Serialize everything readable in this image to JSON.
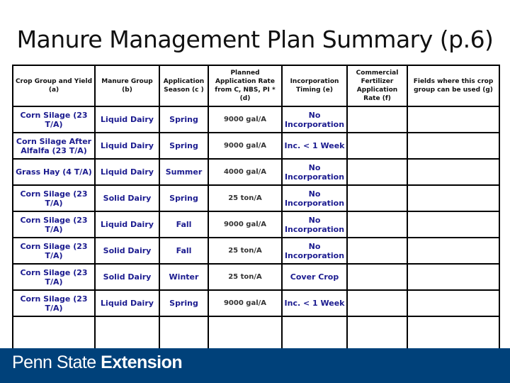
{
  "title": "Manure Management Plan Summary (p.6)",
  "table": {
    "headers": [
      "Crop Group and Yield (a)",
      "Manure Group (b)",
      "Application Season (c )",
      "Planned Application Rate from C, NBS, PI * (d)",
      "Incorporation Timing (e)",
      "Commercial Fertilizer Application Rate (f)",
      "Fields where this crop group can be used (g)"
    ],
    "rows": [
      [
        "Corn Silage (23 T/A)",
        "Liquid Dairy",
        "Spring",
        "9000 gal/A",
        "No Incorporation",
        "",
        ""
      ],
      [
        "Corn Silage After Alfalfa (23 T/A)",
        "Liquid Dairy",
        "Spring",
        "9000 gal/A",
        "Inc. < 1 Week",
        "",
        ""
      ],
      [
        "Grass Hay (4 T/A)",
        "Liquid Dairy",
        "Summer",
        "4000 gal/A",
        "No Incorporation",
        "",
        ""
      ],
      [
        "Corn Silage (23 T/A)",
        "Solid Dairy",
        "Spring",
        "25 ton/A",
        "No Incorporation",
        "",
        ""
      ],
      [
        "Corn Silage (23 T/A)",
        "Liquid Dairy",
        "Fall",
        "9000 gal/A",
        "No Incorporation",
        "",
        ""
      ],
      [
        "Corn Silage (23 T/A)",
        "Solid Dairy",
        "Fall",
        "25 ton/A",
        "No Incorporation",
        "",
        ""
      ],
      [
        "Corn Silage (23 T/A)",
        "Solid Dairy",
        "Winter",
        "25 ton/A",
        "Cover Crop",
        "",
        ""
      ],
      [
        "Corn Silage (23 T/A)",
        "Liquid Dairy",
        "Spring",
        "9000 gal/A",
        "Inc. < 1 Week",
        "",
        ""
      ],
      [
        "",
        "",
        "",
        "",
        "",
        "",
        ""
      ]
    ]
  },
  "footer": {
    "brand_light": "Penn State",
    "brand_bold": "Extension",
    "background": "#00417a"
  },
  "colors": {
    "cell_text": "#1b1b8f"
  }
}
